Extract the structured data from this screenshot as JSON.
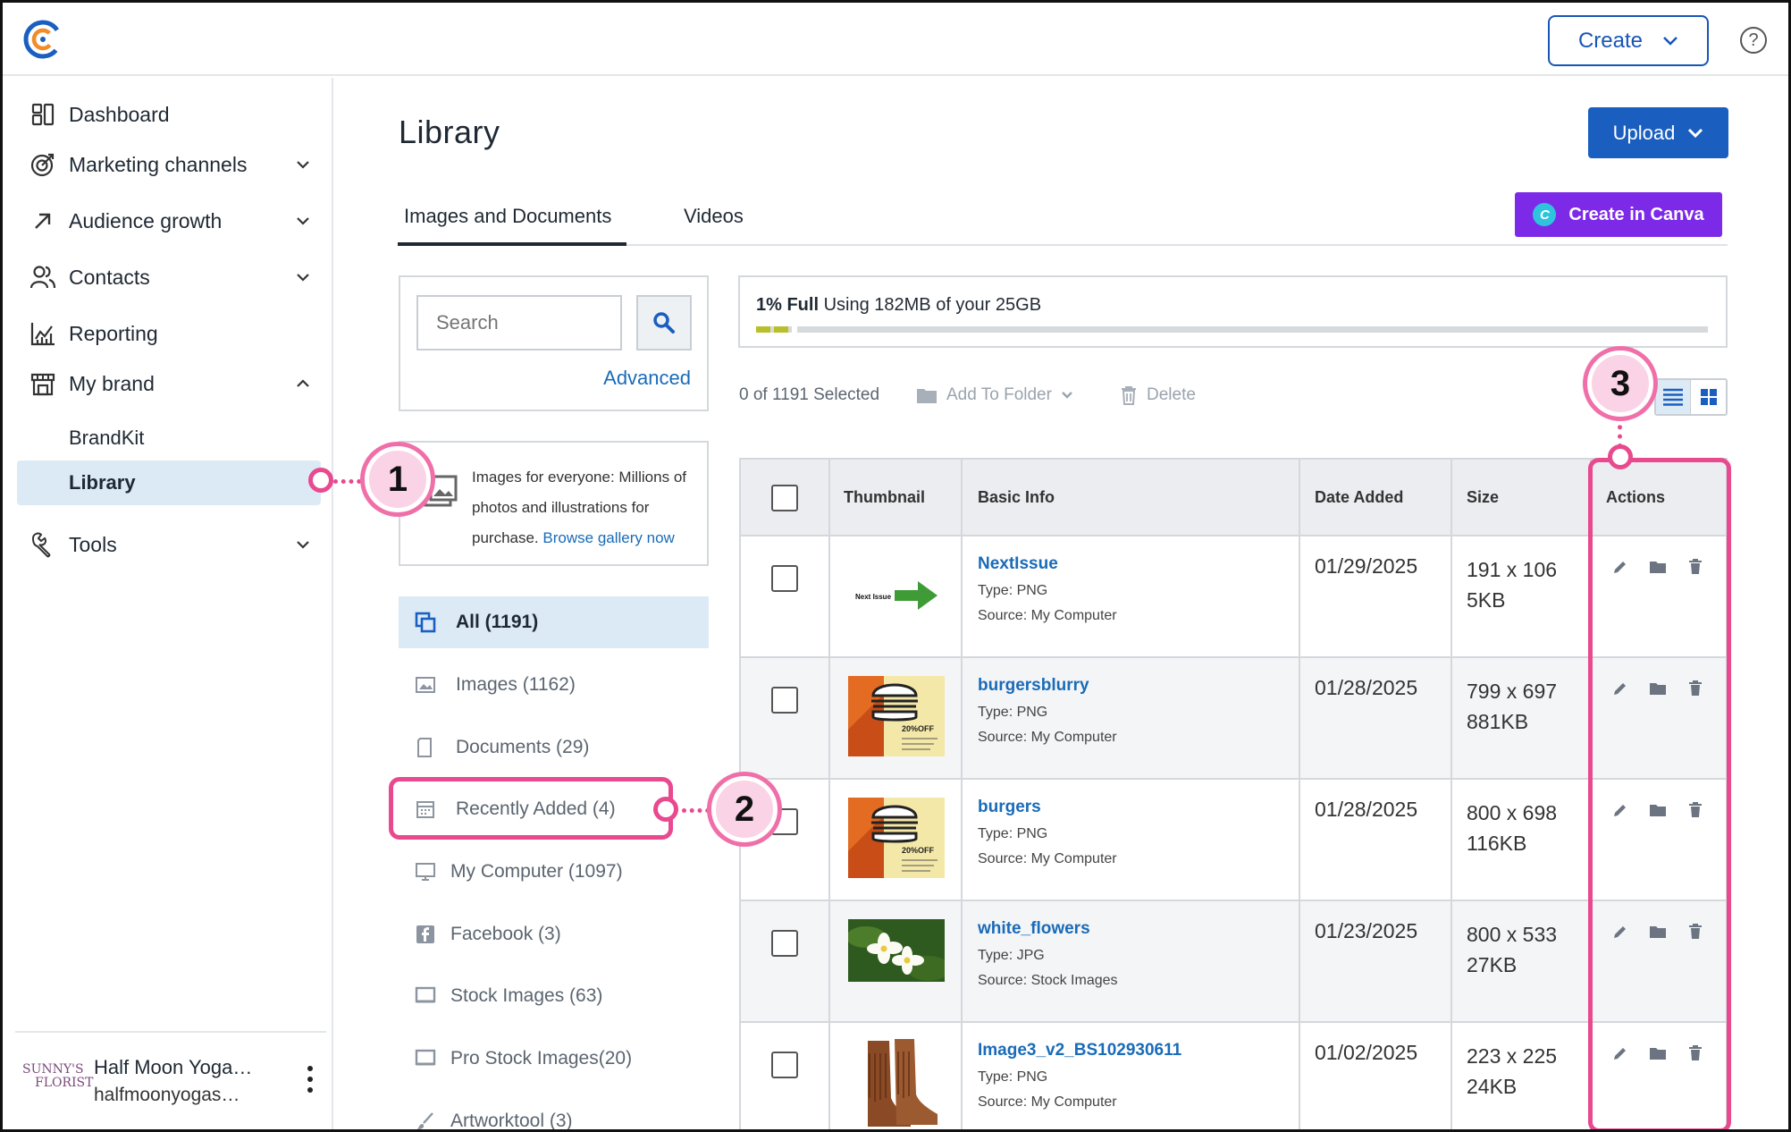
{
  "header": {
    "create_label": "Create",
    "help_symbol": "?"
  },
  "sidebar": {
    "items": [
      {
        "label": "Dashboard",
        "icon": "dashboard-icon"
      },
      {
        "label": "Marketing channels",
        "icon": "target-icon"
      },
      {
        "label": "Audience growth",
        "icon": "arrow-up-right-icon"
      },
      {
        "label": "Contacts",
        "icon": "users-icon"
      },
      {
        "label": "Reporting",
        "icon": "chart-icon"
      },
      {
        "label": "My brand",
        "icon": "store-icon"
      },
      {
        "label": "Tools",
        "icon": "wrench-icon"
      }
    ],
    "brand_sub": [
      {
        "label": "BrandKit"
      },
      {
        "label": "Library"
      }
    ],
    "account": {
      "name": "Half Moon Yoga…",
      "email": "halfmoonyogas…",
      "logo_line1": "SUNNY'S",
      "logo_line2": "FLORIST"
    }
  },
  "main": {
    "title": "Library",
    "upload_label": "Upload",
    "canva_label": "Create in Canva",
    "canva_mark": "C",
    "tabs": [
      {
        "label": "Images and Documents"
      },
      {
        "label": "Videos"
      }
    ]
  },
  "search": {
    "placeholder": "Search",
    "advanced_label": "Advanced"
  },
  "gallery": {
    "text": "Images for everyone: Millions of photos and illustrations for purchase.",
    "link": "Browse gallery now"
  },
  "filters": [
    {
      "label": "All (1191)"
    },
    {
      "label": "Images (1162)"
    },
    {
      "label": "Documents (29)"
    },
    {
      "label": "Recently Added (4)"
    },
    {
      "label": "My Computer (1097)"
    },
    {
      "label": "Facebook (3)"
    },
    {
      "label": "Stock Images (63)"
    },
    {
      "label": "Pro Stock Images(20)"
    },
    {
      "label": "Artworktool (3)"
    }
  ],
  "storage": {
    "percent_label": "1% Full",
    "usage_text": "Using 182MB of your 25GB",
    "percent": 1
  },
  "toolbar": {
    "selected_text": "0 of 1191 Selected",
    "add_to_folder": "Add To Folder",
    "delete": "Delete"
  },
  "table": {
    "headers": {
      "thumbnail": "Thumbnail",
      "basic_info": "Basic Info",
      "date_added": "Date Added",
      "size": "Size",
      "actions": "Actions"
    },
    "rows": [
      {
        "name": "NextIssue",
        "type": "Type: PNG",
        "source": "Source: My Computer",
        "date": "01/29/2025",
        "dims": "191 x 106",
        "size": "5KB",
        "thumb_text": "Next Issue"
      },
      {
        "name": "burgersblurry",
        "type": "Type: PNG",
        "source": "Source: My Computer",
        "date": "01/28/2025",
        "dims": "799 x 697",
        "size": "881KB",
        "thumb_text": "20%OFF"
      },
      {
        "name": "burgers",
        "type": "Type: PNG",
        "source": "Source: My Computer",
        "date": "01/28/2025",
        "dims": "800 x 698",
        "size": "116KB",
        "thumb_text": "20%OFF"
      },
      {
        "name": "white_flowers",
        "type": "Type: JPG",
        "source": "Source: Stock Images",
        "date": "01/23/2025",
        "dims": "800 x 533",
        "size": "27KB"
      },
      {
        "name": "Image3_v2_BS102930611",
        "type": "Type: PNG",
        "source": "Source: My Computer",
        "date": "01/02/2025",
        "dims": "223 x 225",
        "size": "24KB"
      }
    ]
  },
  "annotations": [
    {
      "label": "1"
    },
    {
      "label": "2"
    },
    {
      "label": "3"
    }
  ],
  "colors": {
    "brand_blue": "#1a5fc0",
    "canva_purple": "#7d2ae8",
    "annotation_pink": "#e8498f",
    "link_blue": "#1a6bb8",
    "active_bg": "#dceaf6"
  }
}
